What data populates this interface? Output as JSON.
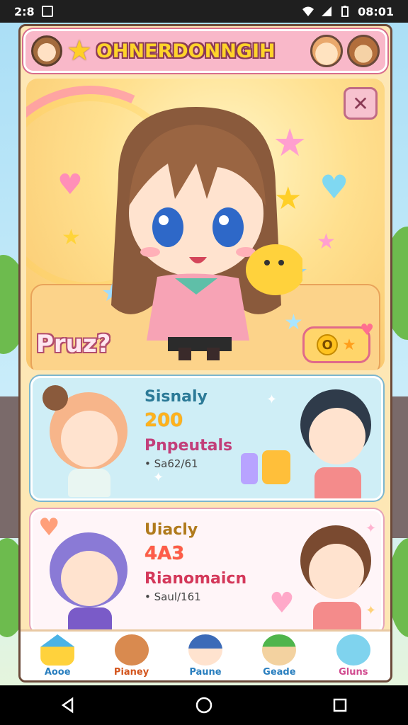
{
  "status_bar": {
    "left_text": "2:8",
    "time": "08:01"
  },
  "header": {
    "title": "OHNERDONNGIH"
  },
  "hero": {
    "score_label": "Pruz?",
    "coin_value": "O"
  },
  "cards": [
    {
      "title": "Sisnaly",
      "value": "200",
      "subtitle": "Pnpeutals",
      "meta": "• Sa62/61"
    },
    {
      "title": "Uiacly",
      "value": "4A3",
      "subtitle": "Rianomaicn",
      "meta": "• Saul/161"
    }
  ],
  "bottom_nav": {
    "items": [
      {
        "label": "Aooe",
        "icon": "house-icon"
      },
      {
        "label": "Pianey",
        "icon": "bear-icon"
      },
      {
        "label": "Paune",
        "icon": "ninja-icon"
      },
      {
        "label": "Geade",
        "icon": "frog-icon"
      },
      {
        "label": "Gluns",
        "icon": "bunny-icon"
      }
    ]
  },
  "colors": {
    "header_bg": "#f9b8c9",
    "panel_bg": "#fde7b5",
    "accent_yellow": "#ffd32a",
    "accent_pink": "#e06a8a",
    "card1_bg": "#cfeef6",
    "card2_bg": "#fff5f8"
  }
}
